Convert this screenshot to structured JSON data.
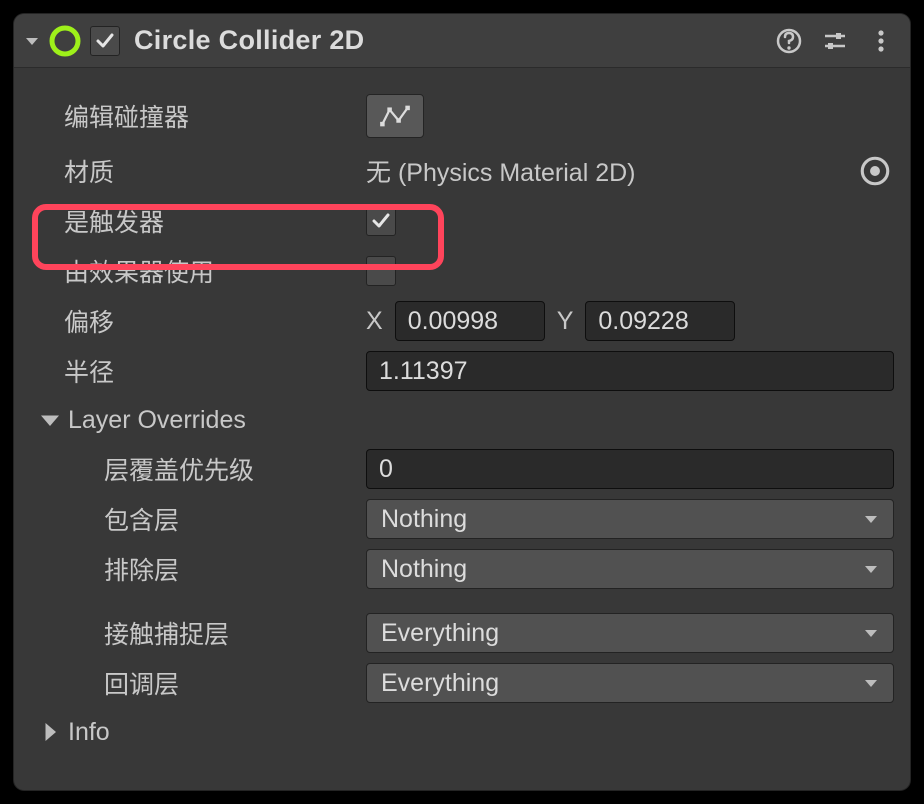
{
  "header": {
    "title": "Circle Collider 2D",
    "enabled": true
  },
  "fields": {
    "edit_collider": {
      "label": "编辑碰撞器"
    },
    "material": {
      "label": "材质",
      "value": "无 (Physics Material 2D)"
    },
    "is_trigger": {
      "label": "是触发器",
      "checked": true
    },
    "used_by_effector": {
      "label": "由效果器使用",
      "checked": false
    },
    "offset": {
      "label": "偏移",
      "x_label": "X",
      "x": "0.00998",
      "y_label": "Y",
      "y": "0.09228"
    },
    "radius": {
      "label": "半径",
      "value": "1.11397"
    }
  },
  "layer_overrides": {
    "title": "Layer Overrides",
    "priority": {
      "label": "层覆盖优先级",
      "value": "0"
    },
    "include": {
      "label": "包含层",
      "value": "Nothing"
    },
    "exclude": {
      "label": "排除层",
      "value": "Nothing"
    },
    "contact_capture": {
      "label": "接触捕捉层",
      "value": "Everything"
    },
    "callback": {
      "label": "回调层",
      "value": "Everything"
    }
  },
  "info": {
    "title": "Info"
  }
}
